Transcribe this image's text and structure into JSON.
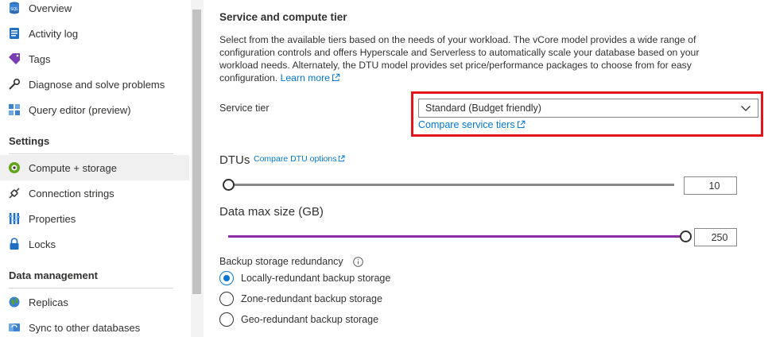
{
  "sidebar": {
    "items_top": [
      {
        "label": "Overview",
        "icon": "sql-database-icon"
      },
      {
        "label": "Activity log",
        "icon": "activity-log-icon"
      },
      {
        "label": "Tags",
        "icon": "tag-icon"
      },
      {
        "label": "Diagnose and solve problems",
        "icon": "wrench-icon"
      },
      {
        "label": "Query editor (preview)",
        "icon": "query-editor-icon"
      }
    ],
    "settings_title": "Settings",
    "settings_items": [
      {
        "label": "Compute + storage",
        "icon": "compute-storage-icon",
        "active": true
      },
      {
        "label": "Connection strings",
        "icon": "connection-plug-icon"
      },
      {
        "label": "Properties",
        "icon": "properties-bars-icon"
      },
      {
        "label": "Locks",
        "icon": "lock-icon"
      }
    ],
    "data_mgmt_title": "Data management",
    "data_mgmt_items": [
      {
        "label": "Replicas",
        "icon": "globe-icon"
      },
      {
        "label": "Sync to other databases",
        "icon": "sync-icon"
      }
    ]
  },
  "main": {
    "section_title": "Service and compute tier",
    "description": "Select from the available tiers based on the needs of your workload. The vCore model provides a wide range of configuration controls and offers Hyperscale and Serverless to automatically scale your database based on your workload needs. Alternately, the DTU model provides set price/performance packages to choose from for easy configuration.",
    "learn_more": "Learn more",
    "service_tier_label": "Service tier",
    "service_tier_value": "Standard (Budget friendly)",
    "compare_tiers": "Compare service tiers",
    "dtus_title": "DTUs",
    "compare_dtu": "Compare DTU options",
    "dtus_value": "10",
    "dtus_slider_fraction": 0.0,
    "data_size_title": "Data max size (GB)",
    "data_size_value": "250",
    "data_size_slider_fraction": 1.0,
    "backup_label": "Backup storage redundancy",
    "backup_options": [
      {
        "label": "Locally-redundant backup storage",
        "checked": true
      },
      {
        "label": "Zone-redundant backup storage",
        "checked": false
      },
      {
        "label": "Geo-redundant backup storage",
        "checked": false
      }
    ]
  },
  "colors": {
    "accent": "#0078d4",
    "highlight_border": "#e3141c",
    "data_slider": "#8a2da5",
    "dtu_slider": "#8a8886"
  }
}
